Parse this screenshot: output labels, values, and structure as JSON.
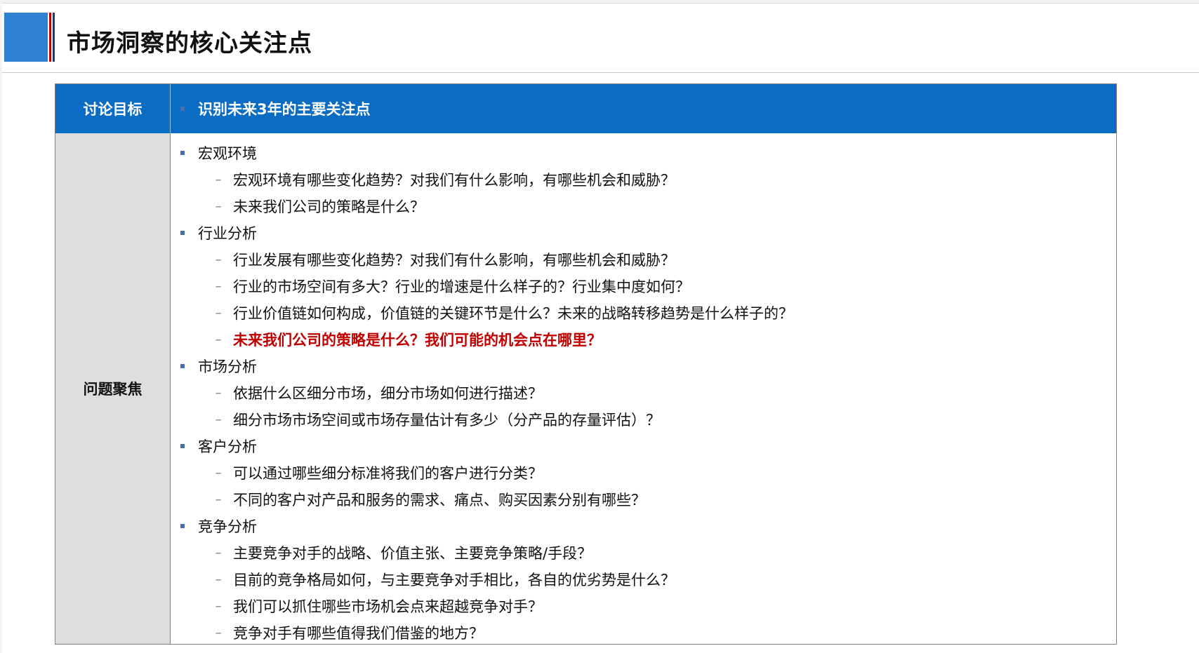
{
  "slide": {
    "title": "市场洞察的核心关注点"
  },
  "header": {
    "left": "讨论目标",
    "right": "识别未来3年的主要关注点"
  },
  "body": {
    "left": "问题聚焦",
    "sections": [
      {
        "heading": "宏观环境",
        "items": [
          {
            "text": "宏观环境有哪些变化趋势？对我们有什么影响，有哪些机会和威胁？",
            "highlight": false
          },
          {
            "text": "未来我们公司的策略是什么？",
            "highlight": false
          }
        ]
      },
      {
        "heading": "行业分析",
        "items": [
          {
            "text": "行业发展有哪些变化趋势？对我们有什么影响，有哪些机会和威胁？",
            "highlight": false
          },
          {
            "text": "行业的市场空间有多大？行业的增速是什么样子的？行业集中度如何？",
            "highlight": false
          },
          {
            "text": "行业价值链如何构成，价值链的关键环节是什么？未来的战略转移趋势是什么样子的？",
            "highlight": false
          },
          {
            "text": "未来我们公司的策略是什么？我们可能的机会点在哪里？",
            "highlight": true
          }
        ]
      },
      {
        "heading": "市场分析",
        "items": [
          {
            "text": "依据什么区细分市场，细分市场如何进行描述？",
            "highlight": false
          },
          {
            "text": "细分市场市场空间或市场存量估计有多少（分产品的存量评估）？",
            "highlight": false
          }
        ]
      },
      {
        "heading": "客户分析",
        "items": [
          {
            "text": "可以通过哪些细分标准将我们的客户进行分类？",
            "highlight": false
          },
          {
            "text": "不同的客户对产品和服务的需求、痛点、购买因素分别有哪些？",
            "highlight": false
          }
        ]
      },
      {
        "heading": "竞争分析",
        "items": [
          {
            "text": "主要竞争对手的战略、价值主张、主要竞争策略/手段？",
            "highlight": false
          },
          {
            "text": "目前的竞争格局如何，与主要竞争对手相比，各自的优劣势是什么？",
            "highlight": false
          },
          {
            "text": "我们可以抓住哪些市场机会点来超越竞争对手？",
            "highlight": false
          },
          {
            "text": "竞争对手有哪些值得我们借鉴的地方？",
            "highlight": false
          }
        ]
      }
    ],
    "dash": "–"
  }
}
